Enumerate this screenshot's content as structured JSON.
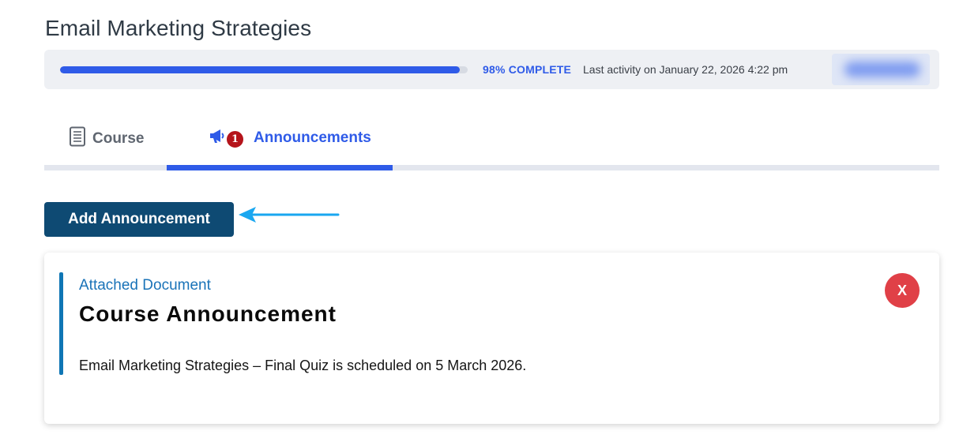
{
  "course": {
    "title": "Email Marketing Strategies"
  },
  "progress": {
    "percent": 98,
    "label": "98% COMPLETE",
    "last_activity": "Last activity on January 22, 2026 4:22 pm"
  },
  "tabs": [
    {
      "label": "Course",
      "icon": "document-icon",
      "active": false
    },
    {
      "label": "Announcements",
      "icon": "megaphone-icon",
      "badge": "1",
      "active": true
    }
  ],
  "actions": {
    "add_announcement_label": "Add Announcement"
  },
  "announcement": {
    "label": "Attached Document",
    "title": "Course Announcement",
    "body": "Email Marketing Strategies – Final Quiz is scheduled on 5 March 2026.",
    "close_label": "X"
  },
  "colors": {
    "accent": "#2f5be8",
    "primary_button": "#0e4a73",
    "badge": "#b5141b",
    "close": "#e04047",
    "card_accent": "#0f76b5",
    "arrow": "#1aa7f0"
  }
}
